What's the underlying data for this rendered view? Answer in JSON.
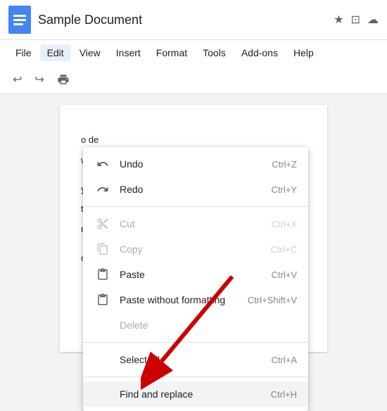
{
  "title": {
    "doc_title": "Sample Document",
    "star_icon": "★",
    "folder_icon": "⊡",
    "cloud_icon": "☁"
  },
  "menubar": {
    "items": [
      "File",
      "Edit",
      "View",
      "Insert",
      "Format",
      "Tools",
      "Add-ons",
      "Help"
    ],
    "active": "Edit"
  },
  "toolbar": {
    "undo_icon": "↩",
    "redo_icon": "↪",
    "print_icon": "🖨"
  },
  "dropdown": {
    "items": [
      {
        "id": "undo",
        "icon": "undo",
        "label": "Undo",
        "shortcut": "Ctrl+Z",
        "disabled": false
      },
      {
        "id": "redo",
        "icon": "redo",
        "label": "Redo",
        "shortcut": "Ctrl+Y",
        "disabled": false
      },
      {
        "divider": true
      },
      {
        "id": "cut",
        "icon": "cut",
        "label": "Cut",
        "shortcut": "Ctrl+X",
        "disabled": true
      },
      {
        "id": "copy",
        "icon": "copy",
        "label": "Copy",
        "shortcut": "Ctrl+C",
        "disabled": true
      },
      {
        "id": "paste",
        "icon": "paste",
        "label": "Paste",
        "shortcut": "Ctrl+V",
        "disabled": false
      },
      {
        "id": "paste-plain",
        "icon": "paste-plain",
        "label": "Paste without formatting",
        "shortcut": "Ctrl+Shift+V",
        "disabled": false
      },
      {
        "id": "delete",
        "icon": "",
        "label": "Delete",
        "shortcut": "",
        "disabled": true
      },
      {
        "divider": true
      },
      {
        "id": "select-all",
        "icon": "",
        "label": "Select all",
        "shortcut": "Ctrl+A",
        "disabled": false
      },
      {
        "divider": true
      },
      {
        "id": "find-replace",
        "icon": "",
        "label": "Find and replace",
        "shortcut": "Ctrl+H",
        "disabled": false,
        "highlighted": true
      }
    ]
  },
  "page": {
    "content_lines": [
      "o de",
      "ws t",
      "y fav",
      "tha",
      "r, a",
      "ons t"
    ]
  }
}
